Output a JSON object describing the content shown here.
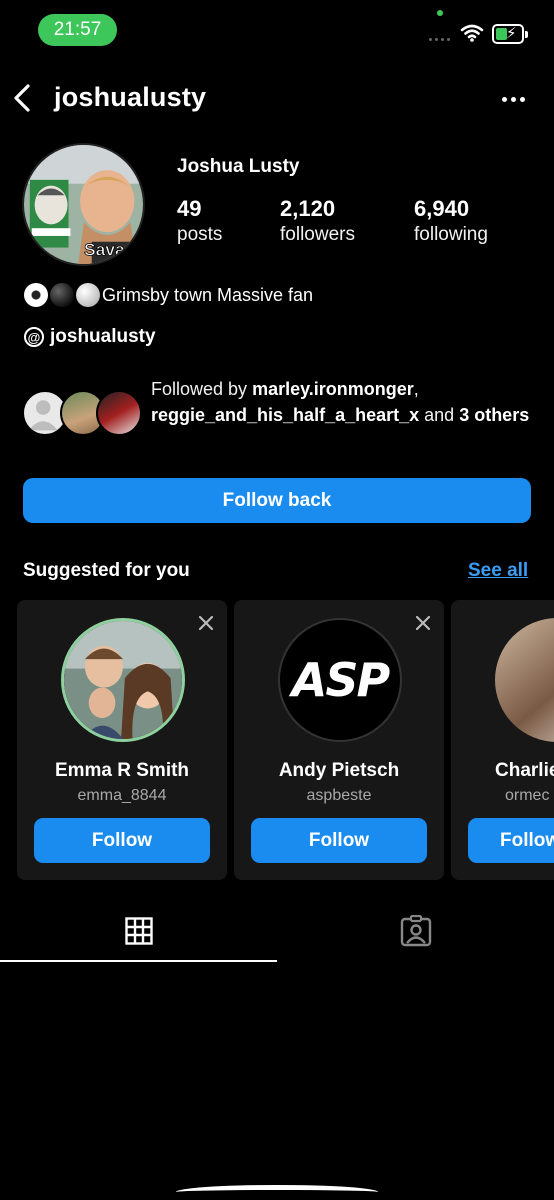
{
  "status_bar": {
    "time": "21:57"
  },
  "header": {
    "username": "joshualusty"
  },
  "profile": {
    "full_name": "Joshua Lusty",
    "avatar_caption": "Savage",
    "stats": [
      {
        "value": "49",
        "label": "posts"
      },
      {
        "value": "2,120",
        "label": "followers"
      },
      {
        "value": "6,940",
        "label": "following"
      }
    ],
    "bio": "Grimsby town Massive fan",
    "threads_handle": "joshualusty",
    "followed_by": {
      "prefix": "Followed by ",
      "user1": "marley.ironmonger",
      "sep": ",",
      "user2": "reggie_and_his_half_a_heart_x",
      "and": " and ",
      "others": "3 others"
    },
    "follow_back_label": "Follow back"
  },
  "suggested": {
    "title": "Suggested for you",
    "see_all": "See all",
    "follow_label": "Follow",
    "cards": [
      {
        "name": "Emma R Smith",
        "handle": "emma_8844"
      },
      {
        "name": "Andy Pietsch",
        "handle": "aspbeste",
        "avatar_text": "ASP"
      },
      {
        "name": "Charlie",
        "handle": "ormec"
      }
    ]
  },
  "colors": {
    "accent": "#1a8cf0",
    "link": "#3b9cf5",
    "status_green": "#3dc75a"
  }
}
